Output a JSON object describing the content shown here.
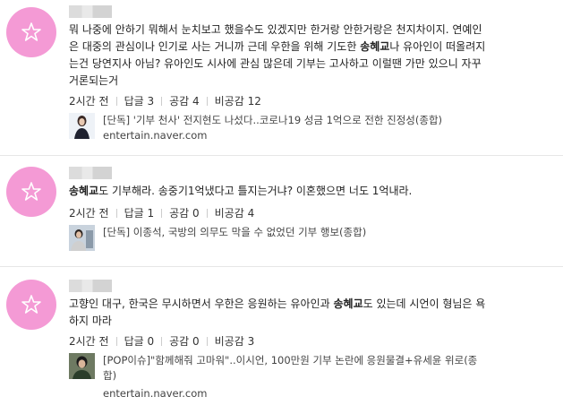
{
  "comments": [
    {
      "text_lines": [
        [
          {
            "t": "뭐 나중에 안하기 뭐해서 눈치보고 했을수도 있겠지만 한거랑 안한거랑은 천지차이지. 연예인"
          }
        ],
        [
          {
            "t": "은 대중의 관심이나 인기로 사는 거니까 근데 우한을 위해 기도한 "
          },
          {
            "t": "송혜교",
            "b": true
          },
          {
            "t": "나 유아인이 떠올려지"
          }
        ],
        [
          {
            "t": "는건 당연지사 아님? 유아인도 시사에 관심 많은데 기부는 고사하고 이럴땐 가만 있으니 자꾸"
          }
        ],
        [
          {
            "t": "거론되는거"
          }
        ]
      ],
      "time": "2시간 전",
      "reply": "답글 3",
      "like": "공감 4",
      "dislike": "비공감 12",
      "link_title": "[단독] '기부 천사' 전지현도 나섰다..코로나19 성금 1억으로 전한 진정성(종합)",
      "link_domain": "entertain.naver.com"
    },
    {
      "text_lines": [
        [
          {
            "t": "송혜교",
            "b": true
          },
          {
            "t": "도 기부해라. 송중기1억냈다고 틀지는거냐? 이혼했으면 너도 1억내라."
          }
        ]
      ],
      "time": "2시간 전",
      "reply": "답글 1",
      "like": "공감 0",
      "dislike": "비공감 4",
      "link_title": "[단독] 이종석, 국방의 의무도 막을 수 없었던 기부 행보(종합)",
      "link_domain": ""
    },
    {
      "text_lines": [
        [
          {
            "t": "고향인 대구, 한국은 무시하면서 우한은 응원하는 유아인과 "
          },
          {
            "t": "송혜교",
            "b": true
          },
          {
            "t": "도 있는데 시언이 형님은 욕"
          }
        ],
        [
          {
            "t": "하지 마라"
          }
        ]
      ],
      "time": "2시간 전",
      "reply": "답글 0",
      "like": "공감 0",
      "dislike": "비공감 3",
      "link_title_lines": [
        "[POP이슈]\"함께해줘 고마워\"..이시언, 100만원 기부 논란에 응원물결+유세윤 위로(종",
        "합)"
      ],
      "link_domain": "entertain.naver.com"
    }
  ],
  "colors": {
    "avatar": "#f49ad5",
    "divider": "#e6e6e6"
  },
  "icons": {
    "avatar": "star-icon"
  }
}
